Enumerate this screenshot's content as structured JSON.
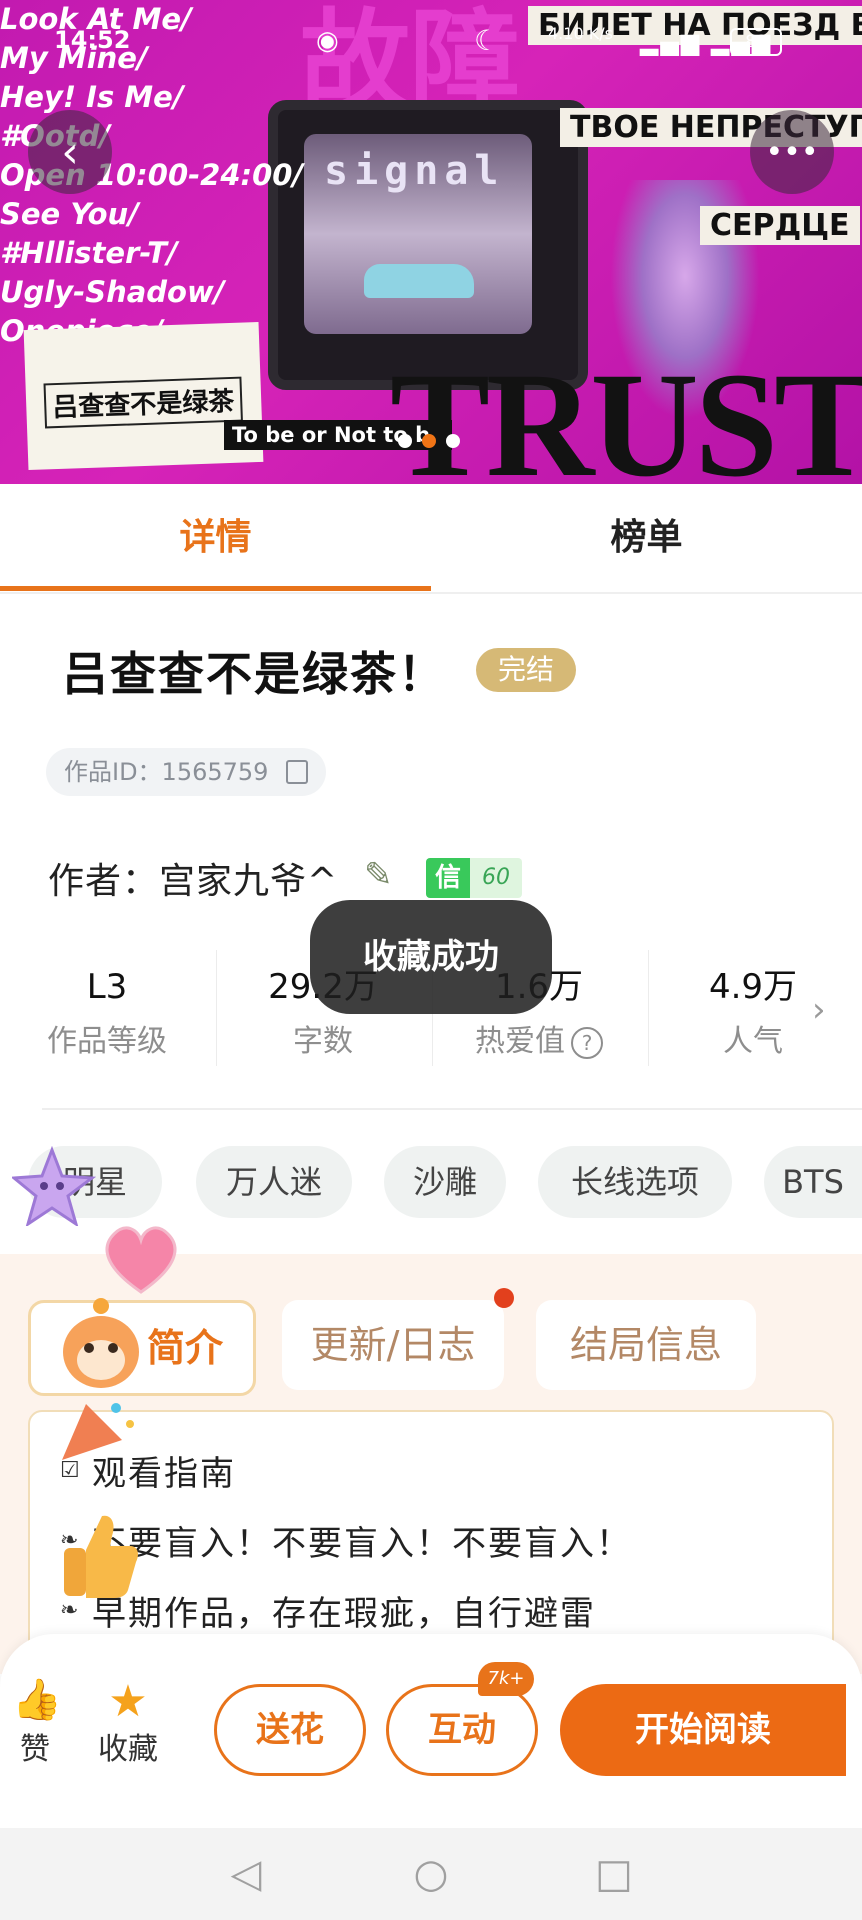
{
  "status_bar": {
    "time": "14:52",
    "net_speed": "4.10 K/s",
    "battery": "88"
  },
  "banner": {
    "big_title": "故障",
    "signal_text": "signal",
    "left_lines": [
      "Look At Me/",
      "My Mine/",
      "Hey! Is Me/",
      "#Ootd/",
      "Open 10:00-24:00/",
      "See You/",
      "#Hllister-T/",
      "Ugly-Shadow/",
      "Onepiece/"
    ],
    "ticket_text": "吕查查不是绿茶",
    "to_be_text": "To be or Not to be",
    "trust_text": "TRUST",
    "cyrillic_1": "БИЛЕТ НА ПОЕЗД В",
    "cyrillic_2": "ТВОЕ НЕПРЕСТУПН",
    "cyrillic_3": "СЕРДЦЕ",
    "carousel_count": 3,
    "carousel_active": 2
  },
  "tabs": {
    "details": "详情",
    "ranking": "榜单",
    "active": "details"
  },
  "work": {
    "title": "吕查查不是绿茶！",
    "status_badge": "完结",
    "id_label": "作品ID：1565759",
    "author_label": "作者：宫家九爷^",
    "credit_key": "信",
    "credit_value": "60"
  },
  "stats": [
    {
      "value": "L3",
      "label": "作品等级"
    },
    {
      "value": "29.2万",
      "label": "字数"
    },
    {
      "value": "1.6万",
      "label": "热爱值"
    },
    {
      "value": "4.9万",
      "label": "人气"
    }
  ],
  "toast": "收藏成功",
  "tags": [
    "明星",
    "万人迷",
    "沙雕",
    "长线选项",
    "BTS"
  ],
  "info_tabs": {
    "intro": "简介",
    "updates": "更新/日志",
    "ending": "结局信息"
  },
  "intro_lines": [
    "观看指南",
    "不要盲入！不要盲入！不要盲入！",
    "早期作品，存在瑕疵，自行避雷"
  ],
  "actions": {
    "like_label": "赞",
    "collect_label": "收藏",
    "flower_label": "送花",
    "interact_label": "互动",
    "interact_badge": "7k+",
    "read_label": "开始阅读"
  },
  "colors": {
    "accent": "#e8731a",
    "badge_gold": "#d6b976",
    "credit_green": "#39c95b"
  }
}
